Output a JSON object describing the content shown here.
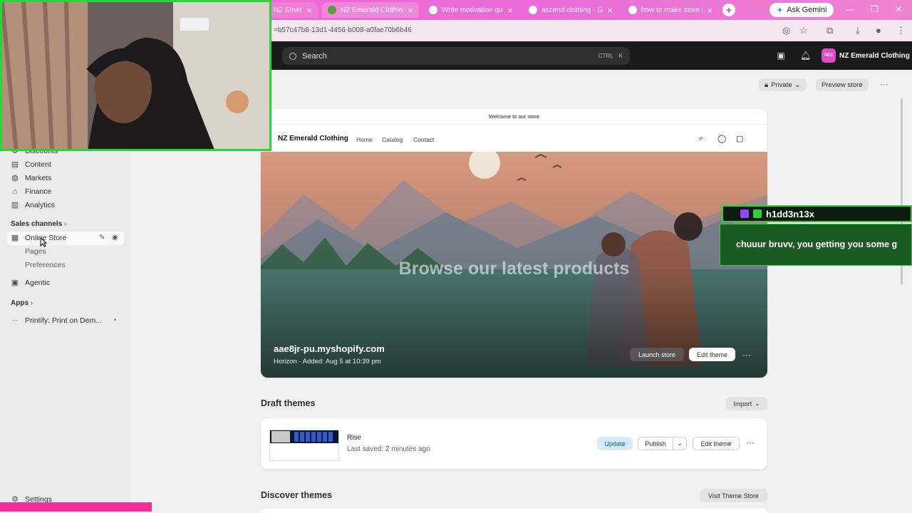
{
  "browser": {
    "tabs": [
      {
        "title": "NZ Emerald",
        "favicon_color": "#e6e6e6"
      },
      {
        "title": "NZ Emerald Clothing",
        "favicon_color": "#5c9e3a"
      },
      {
        "title": "Write motivation qu",
        "favicon_color": "#ffffff"
      },
      {
        "title": "ascend clothing - Go",
        "favicon_color": "#ffffff"
      },
      {
        "title": "how to make store c",
        "favicon_color": "#ffffff"
      }
    ],
    "new_tab": "+",
    "gemini_label": "Ask Gemini",
    "url": "=b57c47b8-13d1-4456-b008-a0fae70b6b46",
    "tab_bar_color": "#e63fb0"
  },
  "topbar": {
    "search_placeholder": "Search",
    "shortcut_ctrl": "CTRL",
    "shortcut_key": "K",
    "store_initials": "NEC",
    "store_name": "NZ Emerald Clothing"
  },
  "sidebar": {
    "items_top": [
      {
        "label": "Discounts",
        "icon": "discount-icon"
      },
      {
        "label": "Content",
        "icon": "content-icon"
      },
      {
        "label": "Markets",
        "icon": "globe-icon"
      },
      {
        "label": "Finance",
        "icon": "bank-icon"
      },
      {
        "label": "Analytics",
        "icon": "bar-chart-icon"
      }
    ],
    "sales_channels_label": "Sales channels",
    "online_store_label": "Online Store",
    "online_store_subitems": [
      "Pages",
      "Preferences"
    ],
    "agentic_label": "Agentic",
    "apps_label": "Apps",
    "printify_label": "Printify: Print on Dem...",
    "settings_label": "Settings"
  },
  "header": {
    "privacy_label": "Private",
    "preview_label": "Preview store",
    "more": "···"
  },
  "current_theme": {
    "announcement": "Welcome to our store",
    "brand": "NZ Emerald Clothing",
    "nav_links": [
      "Home",
      "Catalog",
      "Contact"
    ],
    "hero_title": "Browse our latest products",
    "domain": "aae8jr-pu.myshopify.com",
    "meta": "Horizon · Added: Aug 5 at 10:39 pm",
    "launch_label": "Launch store",
    "edit_label": "Edit theme",
    "more": "···"
  },
  "draft_themes": {
    "title": "Draft themes",
    "import_label": "Import",
    "items": [
      {
        "name": "Rise",
        "saved": "Last saved: 2 minutes ago",
        "update_label": "Update",
        "publish_label": "Publish",
        "edit_label": "Edit theme",
        "more": "···"
      }
    ]
  },
  "discover": {
    "title": "Discover themes",
    "visit_label": "Visit Theme Store"
  },
  "chat_overlay": {
    "username": "h1dd3n13x",
    "message": "chuuur bruvv, you getting you some g"
  },
  "colors": {
    "accent_green": "#2bd33a",
    "shopify_dark": "#1a1a1a",
    "update_blue": "#d5ebff"
  }
}
